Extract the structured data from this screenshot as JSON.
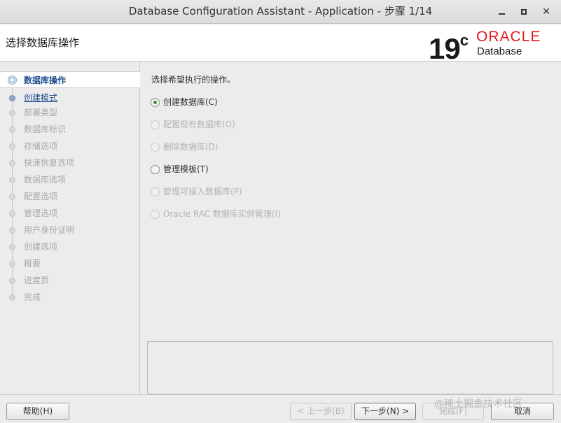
{
  "window": {
    "title": "Database Configuration Assistant - Application - 步骤 1/14"
  },
  "header": {
    "page_title": "选择数据库操作",
    "logo_version": "19",
    "logo_version_suffix": "c",
    "logo_brand": "ORACLE",
    "logo_product": "Database"
  },
  "nav": {
    "items": [
      {
        "label": "数据库操作"
      },
      {
        "label": "创建模式"
      },
      {
        "label": "部署类型"
      },
      {
        "label": "数据库标识"
      },
      {
        "label": "存储选项"
      },
      {
        "label": "快速恢复选项"
      },
      {
        "label": "数据库选项"
      },
      {
        "label": "配置选项"
      },
      {
        "label": "管理选项"
      },
      {
        "label": "用户身份证明"
      },
      {
        "label": "创建选项"
      },
      {
        "label": "概要"
      },
      {
        "label": "进度页"
      },
      {
        "label": "完成"
      }
    ]
  },
  "main": {
    "prompt": "选择希望执行的操作。",
    "options": [
      {
        "label": "创建数据库(C)",
        "checked": true,
        "enabled": true
      },
      {
        "label": "配置现有数据库(O)",
        "checked": false,
        "enabled": false
      },
      {
        "label": "删除数据库(D)",
        "checked": false,
        "enabled": false
      },
      {
        "label": "管理模板(T)",
        "checked": false,
        "enabled": true
      },
      {
        "label": "管理可插入数据库(P)",
        "checked": false,
        "enabled": false
      },
      {
        "label": "Oracle RAC 数据库实例管理(I)",
        "checked": false,
        "enabled": false
      }
    ]
  },
  "footer": {
    "help": "帮助(H)",
    "prev": "< 上一步(B)",
    "next": "下一步(N) >",
    "finish": "完成(F)",
    "cancel": "取消"
  },
  "watermark": "@稀土掘金技术社区",
  "colors": {
    "accent": "#1d4e8f",
    "oracle_red": "#e0191d",
    "selected_radio": "#4a8a3a"
  }
}
